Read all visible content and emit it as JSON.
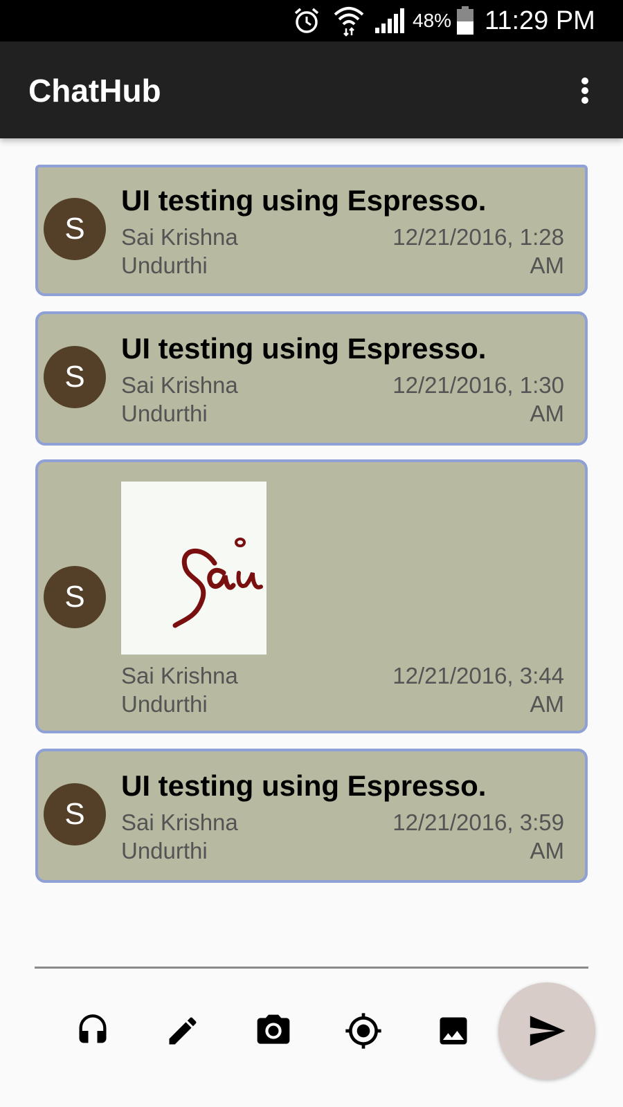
{
  "status_bar": {
    "icons": [
      "alarm-icon",
      "wifi-icon",
      "signal-icon",
      "battery-icon"
    ],
    "battery_percent": "48%",
    "time": "11:29 PM"
  },
  "app_bar": {
    "title": "ChatHub",
    "overflow_icon": "more-vert-icon"
  },
  "messages": [
    {
      "avatar_letter": "S",
      "text": "UI testing using Espresso.",
      "author": "Sai Krishna Undurthi",
      "timestamp": "12/21/2016, 1:28 AM"
    },
    {
      "avatar_letter": "S",
      "text": "UI testing using Espresso.",
      "author": "Sai Krishna Undurthi",
      "timestamp": "12/21/2016, 1:30 AM"
    },
    {
      "avatar_letter": "S",
      "image": "signature-image",
      "author": "Sai Krishna Undurthi",
      "timestamp": "12/21/2016, 3:44 AM"
    },
    {
      "avatar_letter": "S",
      "text": "UI testing using Espresso.",
      "author": "Sai Krishna Undurthi",
      "timestamp": "12/21/2016, 3:59 AM"
    }
  ],
  "composer": {
    "message_input_value": "",
    "tools": [
      "headset-icon",
      "pen-icon",
      "camera-icon",
      "location-icon",
      "image-icon"
    ],
    "send_icon": "send-icon"
  },
  "colors": {
    "status_bar": "#000000",
    "app_bar": "#212121",
    "card_background": "#b7b9a0",
    "card_border": "#8ea0d6",
    "avatar": "#544029",
    "send_fab": "#d7ccc8",
    "signature_ink": "#7a0f0f"
  }
}
